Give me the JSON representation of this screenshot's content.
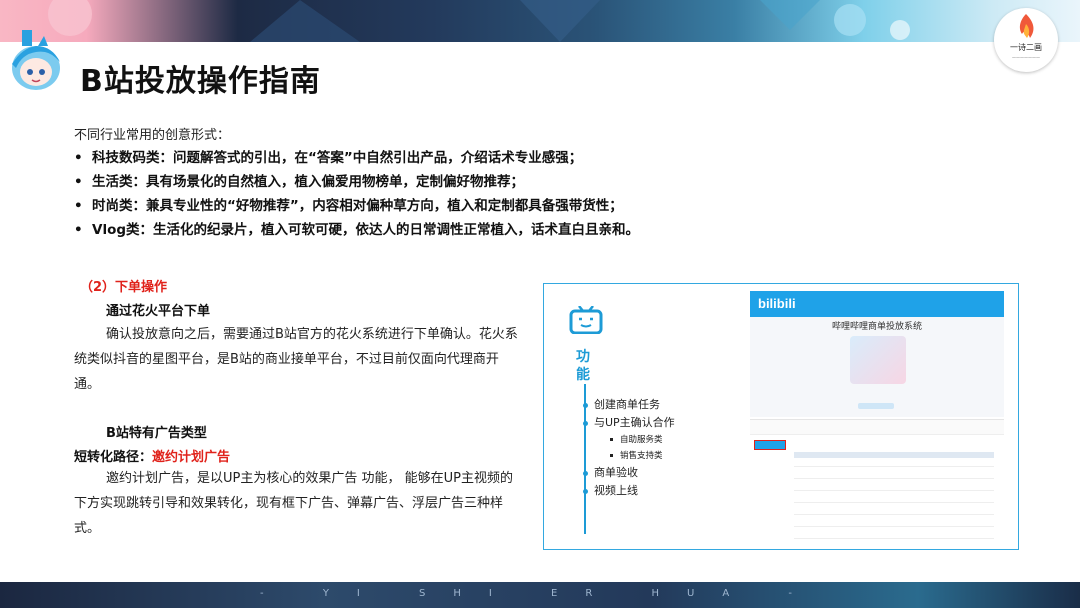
{
  "header": {
    "title": "B站投放操作指南"
  },
  "brand": {
    "name": "一诗二画"
  },
  "intro": "不同行业常用的创意形式：",
  "bullets": [
    "科技数码类：问题解答式的引出，在“答案”中自然引出产品，介绍话术专业感强；",
    "生活类：具有场景化的自然植入，植入偏爱用物榜单，定制偏好物推荐；",
    "时尚类：兼具专业性的“好物推荐”，内容相对偏种草方向，植入和定制都具备强带货性；",
    "Vlog类：生活化的纪录片，植入可软可硬，依达人的日常调性正常植入，话术直白且亲和。"
  ],
  "section": {
    "heading": "（2）下单操作",
    "subheading": "通过花火平台下单",
    "paragraph": "确认投放意向之后，需要通过B站官方的花火系统进行下单确认。花火系统类似抖音的星图平台，是B站的商业接单平台，不过目前仅面向代理商开通。",
    "ad_types_heading": "B站特有广告类型",
    "path_label": "短转化路径：",
    "path_value": "邀约计划广告",
    "ad_paragraph": "邀约计划广告，是以UP主为核心的效果广告 功能， 能够在UP主视频的下方实现跳转引导和效果转化，现有框下广告、弹幕广告、浮层广告三种样式。"
  },
  "screenshot": {
    "function_label": "功能",
    "items": [
      {
        "label": "创建商单任务"
      },
      {
        "label": "与UP主确认合作"
      },
      {
        "label": "商单验收"
      },
      {
        "label": "视频上线"
      }
    ],
    "sub_items": [
      "自助服务类",
      "销售支持类"
    ],
    "bili_logo": "bilibili",
    "system_title": "哔哩哔哩商单投放系统"
  },
  "footer": {
    "text": "- YI SHI ER HUA -"
  },
  "colors": {
    "accent_red": "#e0221b",
    "accent_blue": "#1d9bd6"
  }
}
